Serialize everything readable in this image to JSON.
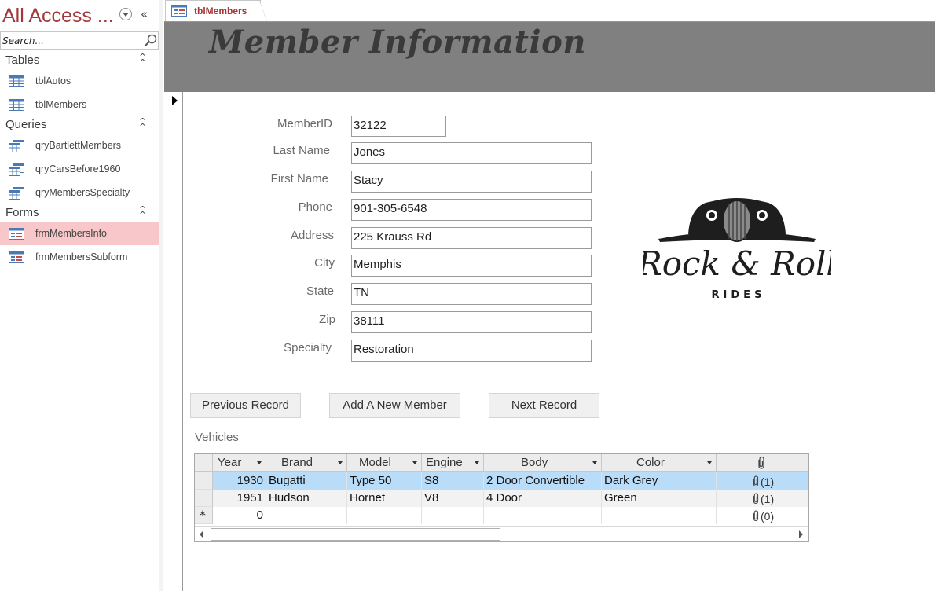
{
  "nav": {
    "title": "All Access ...",
    "search_placeholder": "Search...",
    "groups": [
      {
        "label": "Tables",
        "items": [
          {
            "label": "tblAutos"
          },
          {
            "label": "tblMembers"
          }
        ]
      },
      {
        "label": "Queries",
        "items": [
          {
            "label": "qryBartlettMembers"
          },
          {
            "label": "qryCarsBefore1960"
          },
          {
            "label": "qryMembersSpecialty"
          }
        ]
      },
      {
        "label": "Forms",
        "items": [
          {
            "label": "frmMembersInfo",
            "selected": true
          },
          {
            "label": "frmMembersSubform"
          }
        ]
      }
    ]
  },
  "doc_tab": {
    "label": "tblMembers"
  },
  "form": {
    "title": "Member Information",
    "fields": [
      {
        "label": "MemberID",
        "value": "32122"
      },
      {
        "label": "Last Name",
        "value": "Jones"
      },
      {
        "label": "First Name",
        "value": "Stacy"
      },
      {
        "label": "Phone",
        "value": "901-305-6548"
      },
      {
        "label": "Address",
        "value": "225 Krauss Rd"
      },
      {
        "label": "City",
        "value": "Memphis"
      },
      {
        "label": "State",
        "value": "TN"
      },
      {
        "label": "Zip",
        "value": "38111"
      },
      {
        "label": "Specialty",
        "value": "Restoration"
      }
    ],
    "logo": {
      "line1": "Rock & Roll",
      "line2": "RIDES"
    },
    "buttons": {
      "previous": "Previous Record",
      "add": "Add A New Member",
      "next": "Next Record"
    },
    "subform_label": "Vehicles"
  },
  "grid": {
    "columns": [
      "Year",
      "Brand",
      "Model",
      "Engine",
      "Body",
      "Color"
    ],
    "rows": [
      {
        "year": "1930",
        "brand": "Bugatti",
        "model": "Type 50",
        "engine": "S8",
        "body": "2 Door Convertible",
        "color": "Dark Grey",
        "attach": "(1)"
      },
      {
        "year": "1951",
        "brand": "Hudson",
        "model": "Hornet",
        "engine": "V8",
        "body": "4 Door",
        "color": "Green",
        "attach": "(1)"
      },
      {
        "year": "0",
        "brand": "",
        "model": "",
        "engine": "",
        "body": "",
        "color": "",
        "attach": "(0)"
      }
    ],
    "new_row_marker": "*"
  },
  "colors": {
    "accent": "#a4373a",
    "selected_nav": "#f8c7c9",
    "header_band": "#808080",
    "selected_row": "#b9dcf9"
  }
}
